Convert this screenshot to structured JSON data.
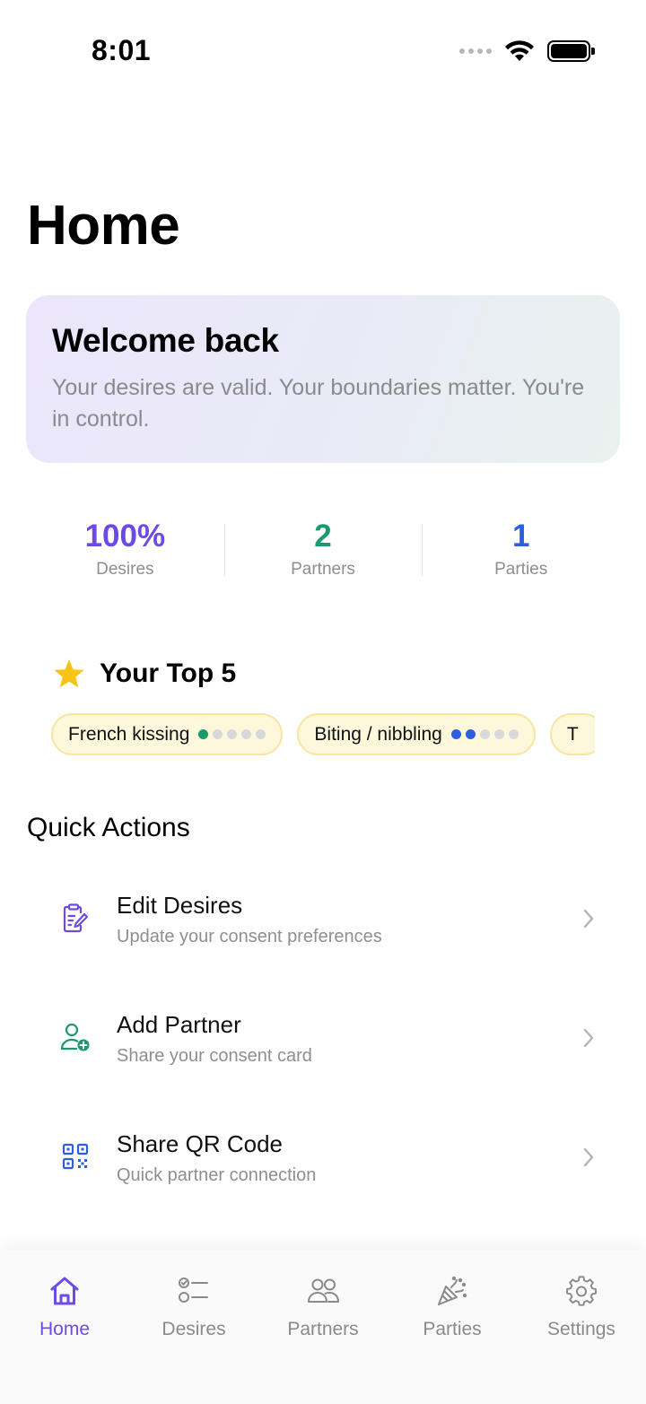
{
  "status_bar": {
    "time": "8:01"
  },
  "page": {
    "title": "Home"
  },
  "welcome": {
    "title": "Welcome back",
    "subtitle": "Your desires are valid. Your boundaries matter. You're in control."
  },
  "stats": [
    {
      "value": "100%",
      "label": "Desires",
      "color": "#6b4ae6"
    },
    {
      "value": "2",
      "label": "Partners",
      "color": "#1b9a6c"
    },
    {
      "value": "1",
      "label": "Parties",
      "color": "#2c5fe0"
    }
  ],
  "top5": {
    "title": "Your Top 5",
    "icon": "star-icon",
    "items": [
      {
        "label": "French kissing",
        "level": 1,
        "level_max": 5,
        "color": "#1b9a6c"
      },
      {
        "label": "Biting / nibbling",
        "level": 2,
        "level_max": 5,
        "color": "#2c5fe0"
      },
      {
        "label": "T",
        "level": 0,
        "level_max": 5,
        "color": "#d9d9dc"
      }
    ]
  },
  "quick_actions": {
    "title": "Quick Actions",
    "items": [
      {
        "label": "Edit Desires",
        "sub": "Update your consent preferences",
        "icon": "clipboard-edit-icon",
        "color": "#6b4ae6"
      },
      {
        "label": "Add Partner",
        "sub": "Share your consent card",
        "icon": "person-add-icon",
        "color": "#1b9a6c"
      },
      {
        "label": "Share QR Code",
        "sub": "Quick partner connection",
        "icon": "qr-code-icon",
        "color": "#2c5fe0"
      }
    ]
  },
  "tab_bar": {
    "active_color": "#6d4be8",
    "items": [
      {
        "label": "Home",
        "icon": "house-icon",
        "active": true
      },
      {
        "label": "Desires",
        "icon": "checklist-icon",
        "active": false
      },
      {
        "label": "Partners",
        "icon": "people-icon",
        "active": false
      },
      {
        "label": "Parties",
        "icon": "party-popper-icon",
        "active": false
      },
      {
        "label": "Settings",
        "icon": "gear-icon",
        "active": false
      }
    ]
  }
}
